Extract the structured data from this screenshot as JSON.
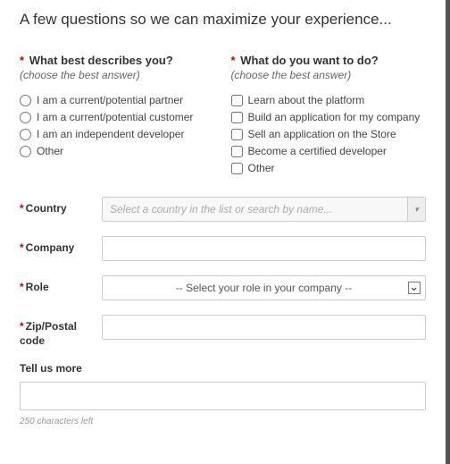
{
  "title": "A few questions so we can maximize your experience...",
  "q1": {
    "label": "What best describes you?",
    "hint": "(choose the best answer)",
    "options": [
      "I am a current/potential partner",
      "I am a current/potential customer",
      "I am an independent developer",
      "Other"
    ]
  },
  "q2": {
    "label": "What do you want to do?",
    "hint": "(choose the best answer)",
    "options": [
      "Learn about the platform",
      "Build an application for my company",
      "Sell an application on the Store",
      "Become a certified developer",
      "Other"
    ]
  },
  "fields": {
    "country": {
      "label": "Country",
      "placeholder": "Select a country in the list or search by name..."
    },
    "company": {
      "label": "Company",
      "value": ""
    },
    "role": {
      "label": "Role",
      "placeholder": "-- Select your role in your company --"
    },
    "zip": {
      "label": "Zip/Postal code",
      "value": ""
    }
  },
  "tellmore": {
    "label": "Tell us more",
    "value": "",
    "char_count": "250 characters left"
  },
  "asterisk": "*"
}
